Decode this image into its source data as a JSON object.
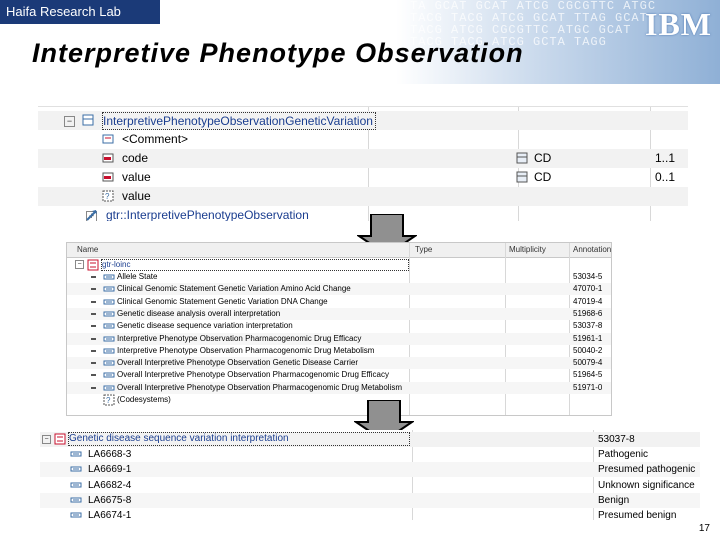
{
  "header": {
    "lab": "Haifa Research Lab",
    "logo": "IBM",
    "dna_text": "TA GCAT GCAT ATCG CGCGTTC ATGC TACG TACG ATCG GCAT TTAG GCAT TACG ATCG CGCGTTC ATGC GCAT TACG TACG ATCG GCTA TAGG"
  },
  "title": "Interpretive Phenotype Observation",
  "panel1": {
    "rows": [
      {
        "label": "InterpretivePhenotypeObservationGeneticVariation",
        "icon": "class-icon",
        "toggle": "−"
      },
      {
        "label": "<Comment>",
        "icon": "comment-icon"
      },
      {
        "label": "code",
        "icon": "attribute-icon",
        "type": "CD",
        "mult": "1..1"
      },
      {
        "label": "value",
        "icon": "attribute-icon",
        "type": "CD",
        "mult": "0..1"
      },
      {
        "label": "value",
        "icon": "constraint-icon"
      },
      {
        "label": "gtr::InterpretivePhenotypeObservation",
        "icon": "association-icon",
        "toggle": "+"
      }
    ]
  },
  "panel2": {
    "headers": {
      "name": "Name",
      "type": "Type",
      "multiplicity": "Multiplicity",
      "annotation": "Annotation"
    },
    "root": "gtr-loinc",
    "rows": [
      {
        "label": "Allele State",
        "code": "53034-5"
      },
      {
        "label": "Clinical Genomic Statement Genetic Variation Amino Acid Change",
        "code": "47070-1"
      },
      {
        "label": "Clinical Genomic Statement Genetic Variation DNA Change",
        "code": "47019-4"
      },
      {
        "label": "Genetic disease analysis overall interpretation",
        "code": "51968-6"
      },
      {
        "label": "Genetic disease sequence variation interpretation",
        "code": "53037-8"
      },
      {
        "label": "Interpretive Phenotype Observation Pharmacogenomic Drug Efficacy",
        "code": "51961-1"
      },
      {
        "label": "Interpretive Phenotype Observation Pharmacogenomic Drug Metabolism",
        "code": "50040-2"
      },
      {
        "label": "Overall Interpretive Phenotype Observation Genetic Disease Carrier",
        "code": "50079-4"
      },
      {
        "label": "Overall Interpretive Phenotype Observation Pharmacogenomic Drug Efficacy",
        "code": "51964-5"
      },
      {
        "label": "Overall Interpretive Phenotype Observation Pharmacogenomic Drug Metabolism",
        "code": "51971-0"
      }
    ],
    "footer": "(Codesystems)"
  },
  "panel3": {
    "root": {
      "label": "Genetic disease sequence variation interpretation",
      "code": "53037-8"
    },
    "rows": [
      {
        "code": "LA6668-3",
        "meaning": "Pathogenic"
      },
      {
        "code": "LA6669-1",
        "meaning": "Presumed pathogenic"
      },
      {
        "code": "LA6682-4",
        "meaning": "Unknown significance"
      },
      {
        "code": "LA6675-8",
        "meaning": "Benign"
      },
      {
        "code": "LA6674-1",
        "meaning": "Presumed benign"
      }
    ]
  },
  "page_number": "17",
  "colors": {
    "banner_dark": "#1b3a78",
    "icon_red": "#c8102e",
    "icon_blue": "#3b6ea5",
    "arrow_gray": "#909090"
  }
}
